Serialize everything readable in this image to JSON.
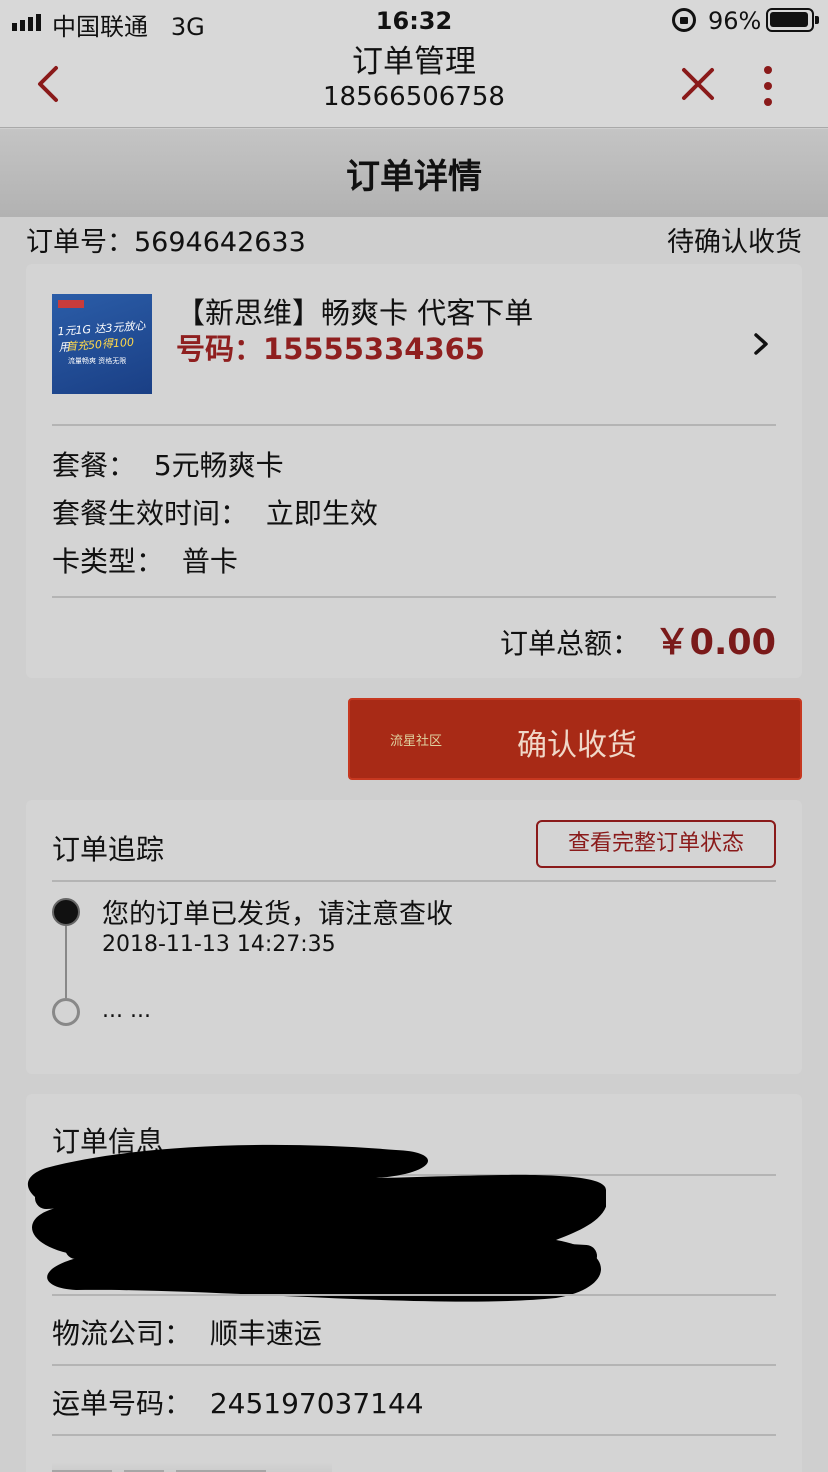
{
  "status_bar": {
    "carrier": "中国联通",
    "network": "3G",
    "time": "16:32",
    "battery": "96%"
  },
  "nav": {
    "title": "订单管理",
    "subtitle": "18566506758",
    "back_icon": "chevron-left-icon",
    "close_icon": "close-icon",
    "more_icon": "more-vertical-icon"
  },
  "section_header": "订单详情",
  "order": {
    "number_label": "订单号：",
    "number": "5694642633",
    "status": "待确认收货"
  },
  "product": {
    "image_lines": [
      "1元1G 达3元放心用",
      "首充50得100",
      "流量畅爽 资格无限"
    ],
    "name": "【新思维】畅爽卡 代客下单",
    "number_label": "号码：",
    "number": "15555334365",
    "details": [
      {
        "label": "套餐：",
        "value": "5元畅爽卡"
      },
      {
        "label": "套餐生效时间：",
        "value": "立即生效"
      },
      {
        "label": "卡类型：",
        "value": "普卡"
      }
    ],
    "total_label": "订单总额：",
    "total_value": "￥0.00"
  },
  "confirm_button": {
    "watermark": "流星社区",
    "label": "确认收货"
  },
  "tracking": {
    "title": "订单追踪",
    "button": "查看完整订单状态",
    "events": [
      {
        "text": "您的订单已发货，请注意查收",
        "time": "2018-11-13 14:27:35"
      }
    ],
    "more": "... ..."
  },
  "order_info": {
    "title": "订单信息",
    "rows": [
      {
        "label": "物流公司：",
        "value": "顺丰速运"
      },
      {
        "label": "运单号码：",
        "value": "245197037144"
      }
    ]
  },
  "colors": {
    "accent": "#a82a16",
    "price": "#7a1a1a",
    "link": "#8a1a1a"
  }
}
